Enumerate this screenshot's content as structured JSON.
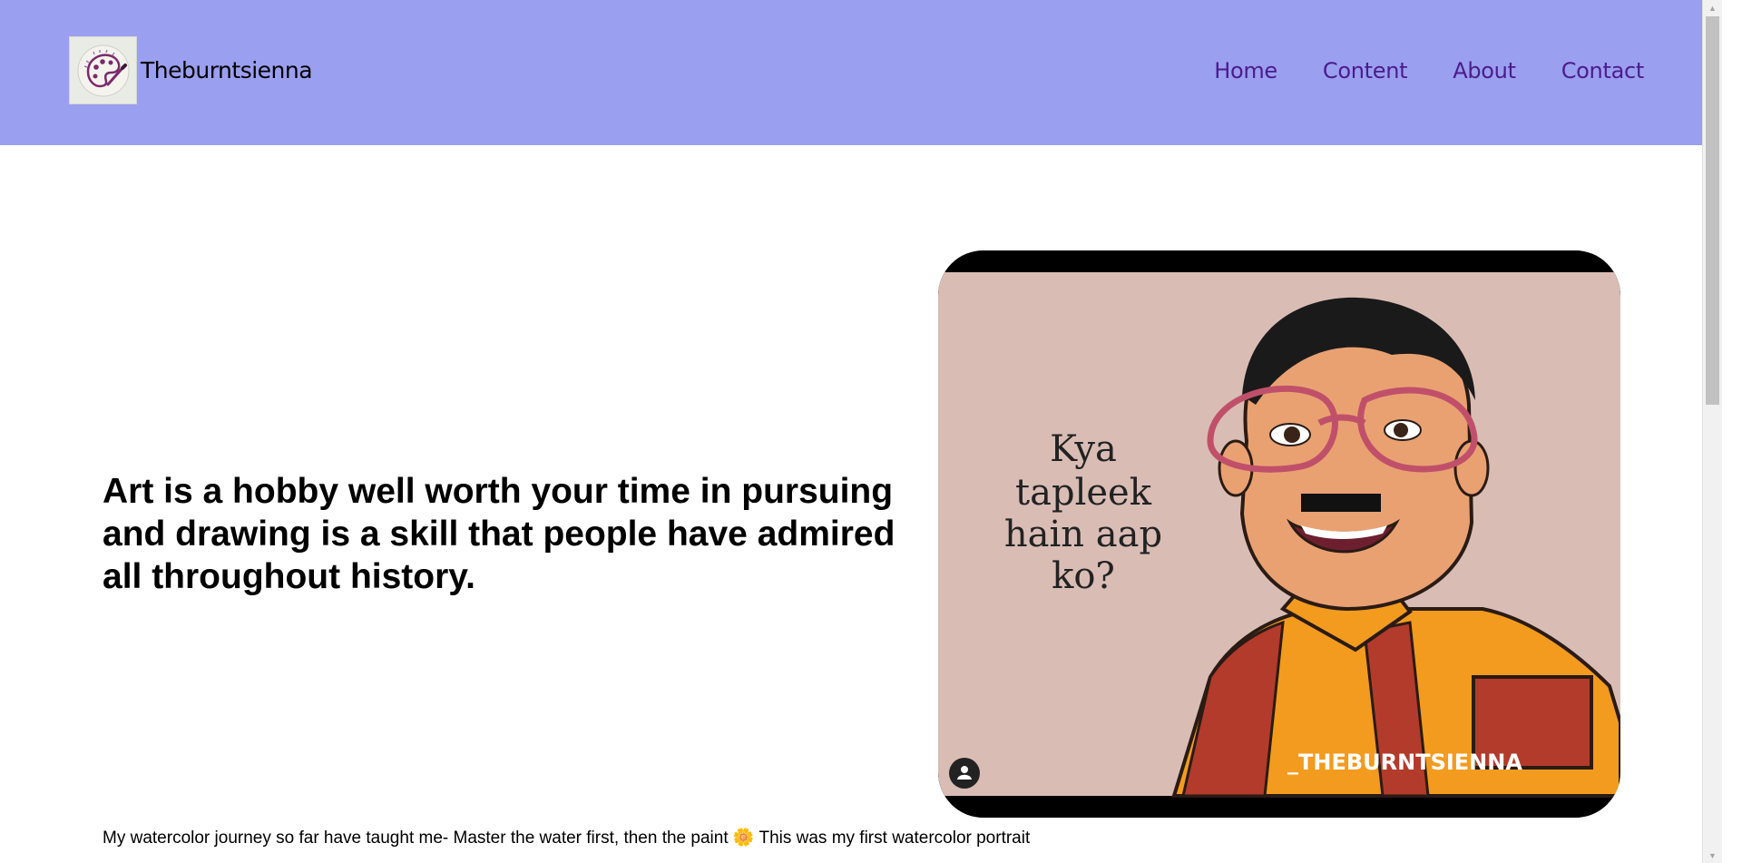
{
  "header": {
    "brand_name": "Theburntsienna",
    "logo_icon": "palette-icon",
    "nav": [
      "Home",
      "Content",
      "About",
      "Contact"
    ]
  },
  "hero": {
    "headline": "Art is a hobby well worth your time in pursuing and drawing is a skill that people have admired all throughout history.",
    "image": {
      "description_icon": "caricature-illustration",
      "text_lines": [
        "Kya",
        "tapleek",
        "hain aap",
        "ko?"
      ],
      "watermark": "_THEBURNTSIENNA"
    }
  },
  "post": {
    "caption": "My watercolor journey so far have taught me- Master the water first, then the paint 🌼 This was my first watercolor portrait"
  },
  "colors": {
    "navbar_bg": "#9b9ff0",
    "nav_link": "#4b1c8c",
    "image_bg": "#d9bdb5"
  }
}
